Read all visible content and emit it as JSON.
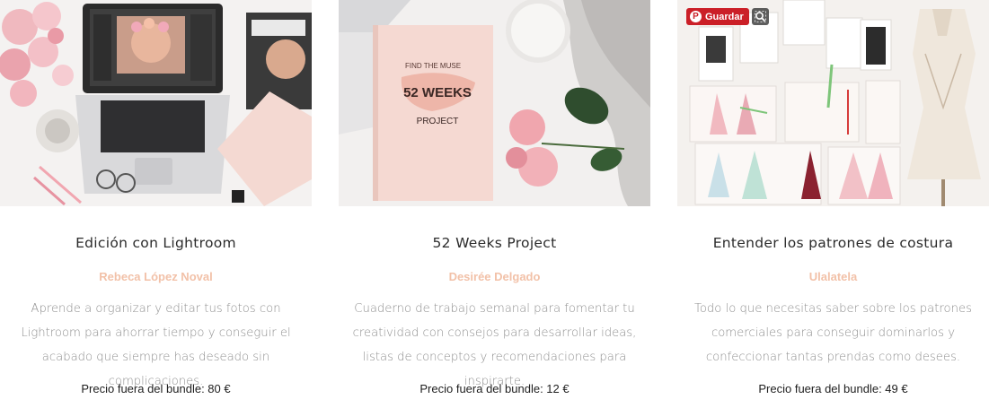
{
  "products": [
    {
      "image_alt": "Laptop with Lightroom, roses and magazines",
      "title": "Edición con Lightroom",
      "author": "Rebeca López Noval",
      "description": "Aprende a organizar y editar tus fotos con Lightroom para ahorrar tiempo y conseguir el acabado que siempre has deseado sin complicaciones.",
      "price": "Precio fuera del bundle: 80 €"
    },
    {
      "image_alt": "52 Weeks Project notebook with roses",
      "notebook_line1": "FIND THE MUSE",
      "notebook_line2": "52 WEEKS",
      "notebook_line3": "PROJECT",
      "title": "52 Weeks Project",
      "author": "Desirée Delgado",
      "description": "Cuaderno de trabajo semanal para fomentar tu creatividad con consejos para desarrollar ideas, listas de conceptos y recomendaciones para inspirarte.",
      "price": "Precio fuera del bundle: 12 €"
    },
    {
      "image_alt": "Fashion sketches on a wall with a dress form",
      "pin_label": "Guardar",
      "title": "Entender los patrones de costura",
      "author": "Ulalatela",
      "description": "Todo lo que necesitas saber sobre los patrones comerciales para conseguir dominarlos y confeccionar tantas prendas como desees.",
      "price": "Precio fuera del bundle: 49 €"
    }
  ],
  "icons": {
    "pinterest": "pinterest-icon",
    "lens": "visual-search-icon"
  },
  "colors": {
    "author": "#f2c1a8",
    "pinterest_red": "#cb1f27"
  }
}
